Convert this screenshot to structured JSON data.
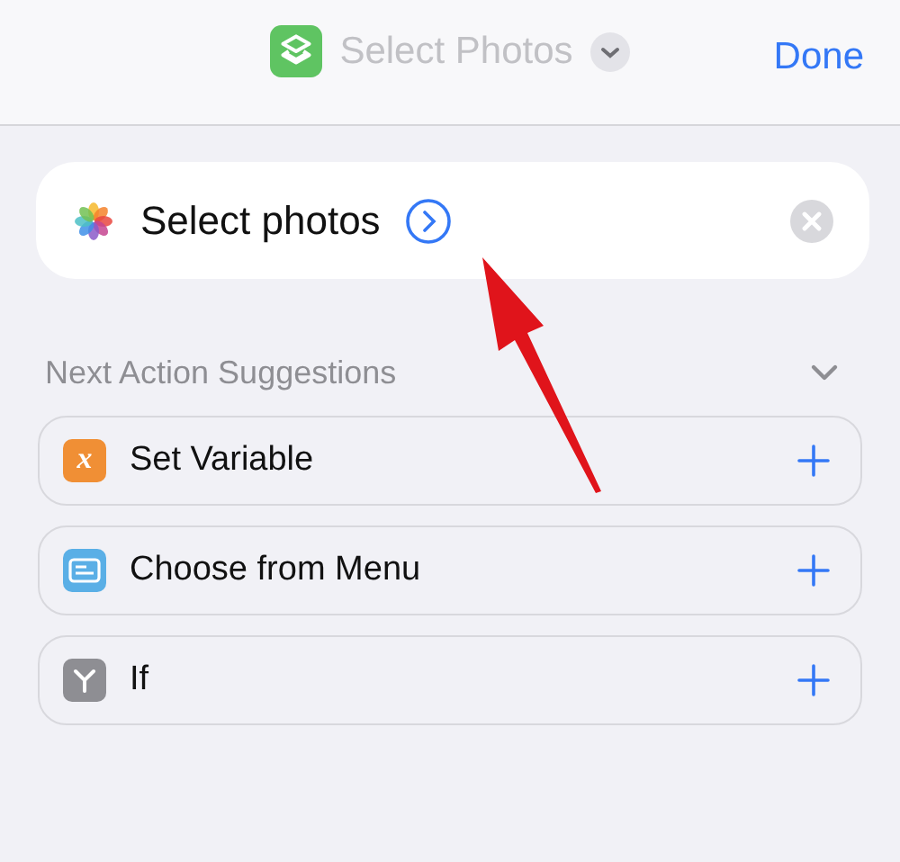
{
  "nav": {
    "title": "Select Photos",
    "done": "Done"
  },
  "action": {
    "title": "Select photos"
  },
  "suggestions": {
    "heading": "Next Action Suggestions",
    "expanded": true,
    "items": [
      {
        "kind": "variable",
        "glyph": "x",
        "label": "Set Variable"
      },
      {
        "kind": "menu",
        "label": "Choose from Menu"
      },
      {
        "kind": "if",
        "label": "If"
      }
    ]
  }
}
